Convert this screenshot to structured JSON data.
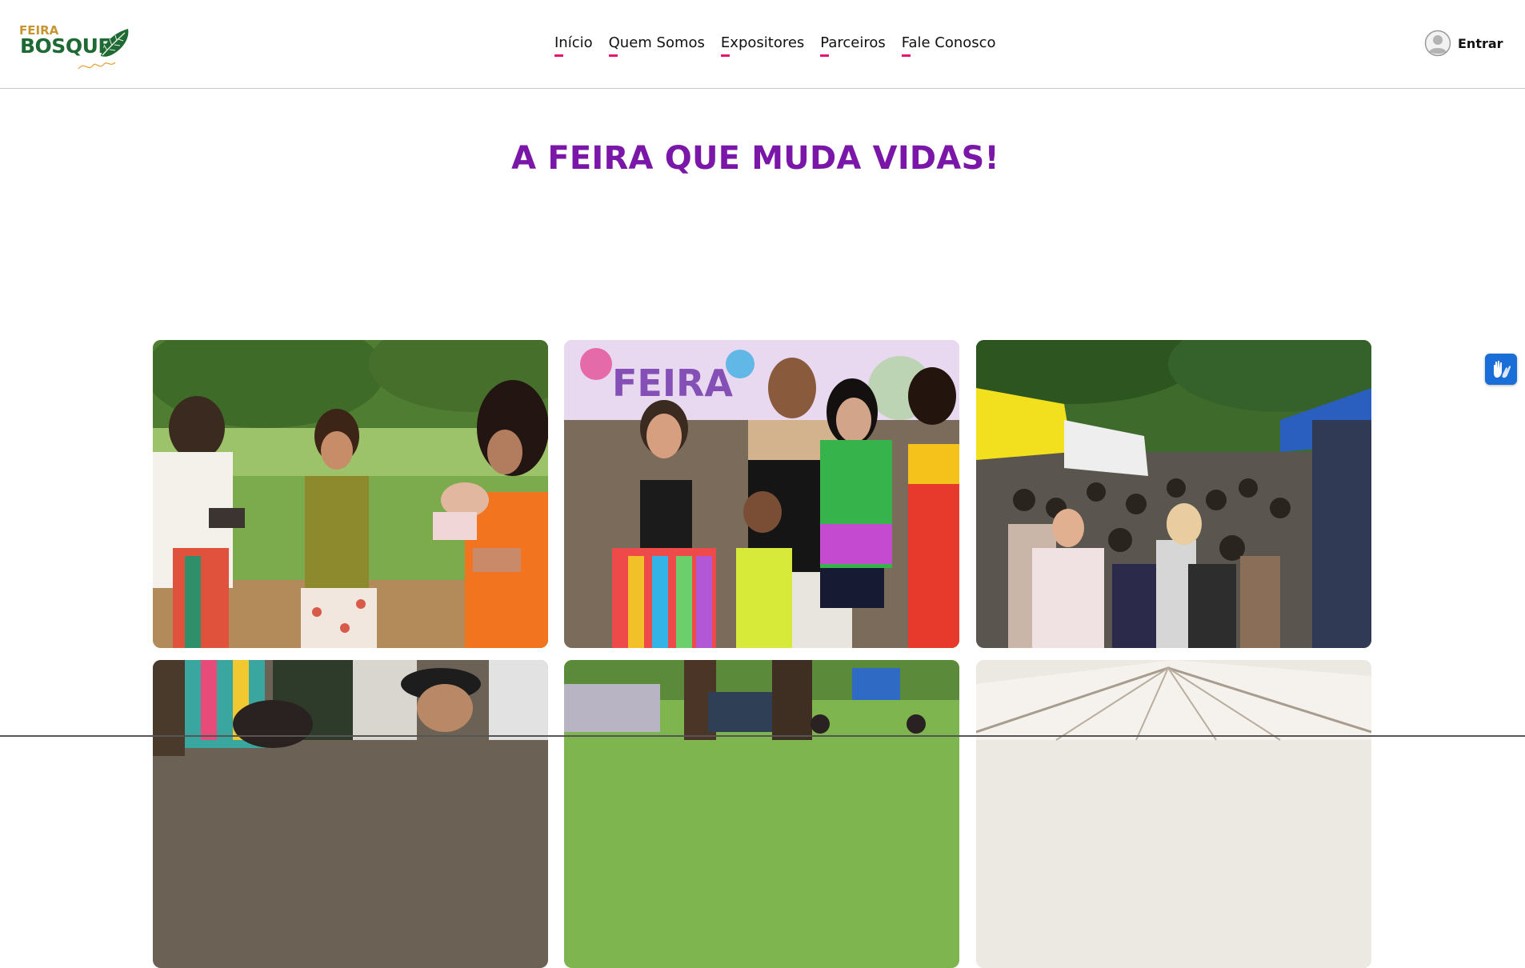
{
  "brand": {
    "logo_top": "FEIRA",
    "logo_main": "BOSQUE",
    "logo_alt": "Feira Bosque logo"
  },
  "nav": {
    "items": [
      {
        "label": "Início"
      },
      {
        "label": "Quem Somos"
      },
      {
        "label": "Expositores"
      },
      {
        "label": "Parceiros"
      },
      {
        "label": "Fale Conosco"
      }
    ],
    "underline_color": "#e6156f"
  },
  "account": {
    "login_label": "Entrar",
    "icon": "user-circle-icon"
  },
  "hero": {
    "title": "A FEIRA QUE MUDA VIDAS!",
    "title_color": "#7a16a8"
  },
  "gallery": {
    "photos": [
      {
        "alt": "Mulheres conversando no parque com bebê no colo"
      },
      {
        "alt": "Família posando em frente ao painel da Feira Bosque"
      },
      {
        "alt": "Multidão caminhando entre as barracas da feira"
      },
      {
        "alt": "Público da feira com chapéu"
      },
      {
        "alt": "Área de brinquedos no gramado"
      },
      {
        "alt": "Interior de tenda branca"
      }
    ]
  },
  "accessibility": {
    "vlibras_icon": "sign-language-hands-icon",
    "color": "#1a6ed8"
  }
}
